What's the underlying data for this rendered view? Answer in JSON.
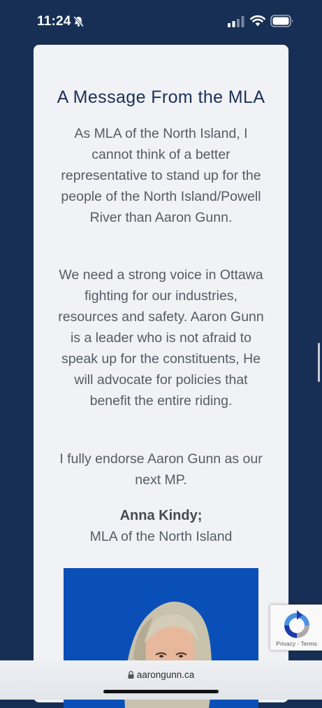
{
  "status_bar": {
    "time": "11:24",
    "icons": [
      "bell-slash-icon",
      "cellular-signal-icon",
      "wifi-icon",
      "battery-icon"
    ]
  },
  "message": {
    "title": "A Message From the MLA",
    "paragraphs": [
      "As MLA of the North Island, I cannot think of a better representative to stand up for the people of the North Island/Powell River than Aaron Gunn.",
      "We need a strong voice in Ottawa fighting for our industries, resources and safety. Aaron Gunn is a leader who is not afraid to speak up for the constituents, He will advocate for policies that benefit the entire riding.",
      "I fully endorse Aaron Gunn as our next MP."
    ],
    "signer_name": "Anna Kindy;",
    "signer_title": "MLA of the North Island"
  },
  "recaptcha": {
    "privacy": "Privacy",
    "separator": " - ",
    "terms": "Terms"
  },
  "browser": {
    "url": "aarongunn.ca"
  },
  "colors": {
    "page_background": "#172f55",
    "card_background": "#f1f2f5",
    "title_color": "#1b2f57",
    "photo_background": "#0a4fb8"
  }
}
